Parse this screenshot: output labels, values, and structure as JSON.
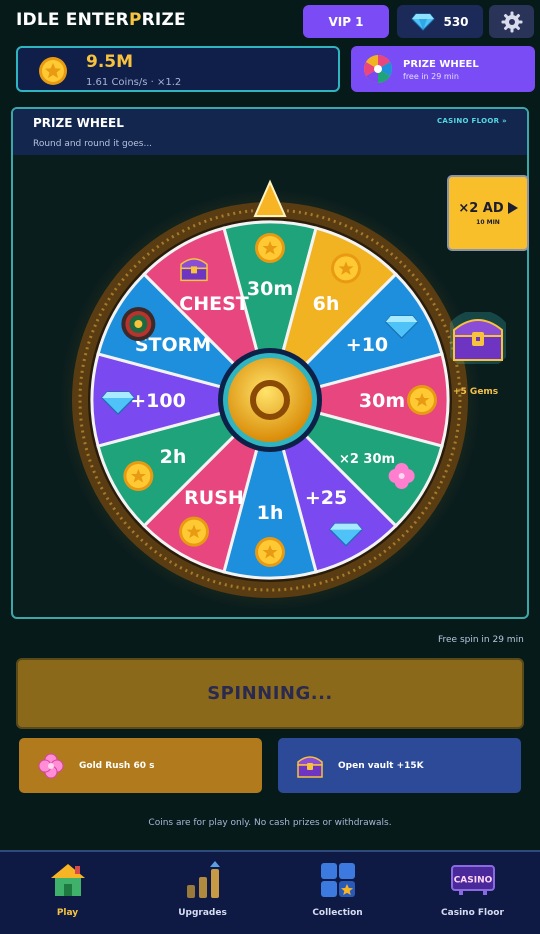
{
  "header": {
    "title_a": "IDLE ENTER",
    "title_b": "P",
    "title_c": "RIZE",
    "vip_label": "VIP 1",
    "gems": "530",
    "settings_icon": "gear-icon"
  },
  "coins": {
    "amount": "9.5M",
    "rate": "1.61 Coins/s  ·  ×1.2",
    "icon": "coin-icon"
  },
  "promo": {
    "title": "PRIZE WHEEL",
    "subtitle": "free in 29 min",
    "icon": "wheel-icon"
  },
  "panel": {
    "title": "PRIZE WHEEL",
    "subtitle": "Round and round it goes...",
    "link": "CASINO FLOOR »"
  },
  "ad_button": {
    "main": "×2 AD",
    "sub": "10 MIN"
  },
  "side_reward": {
    "label": "+5 Gems",
    "icon": "chest-icon"
  },
  "wheel": {
    "segments": [
      {
        "label": "30m",
        "color": "#1fa37a",
        "icon": "coin-icon"
      },
      {
        "label": "6h",
        "color": "#f2b322",
        "icon": "coin-icon"
      },
      {
        "label": "+10",
        "color": "#1d8fdc",
        "icon": "gem-icon"
      },
      {
        "label": "30m",
        "color": "#e8467f",
        "icon": "coin-icon"
      },
      {
        "label": "×2 30m",
        "color": "#1fa37a",
        "icon": "clover-icon"
      },
      {
        "label": "+25",
        "color": "#7a49ef",
        "icon": "gem-icon"
      },
      {
        "label": "1h",
        "color": "#1d8fdc",
        "icon": "coin-icon"
      },
      {
        "label": "RUSH",
        "color": "#e8467f",
        "icon": "coin-icon"
      },
      {
        "label": "2h",
        "color": "#1fa37a",
        "icon": "coin-icon"
      },
      {
        "label": "+100",
        "color": "#7a49ef",
        "icon": "gem-icon"
      },
      {
        "label": "STORM",
        "color": "#1d8fdc",
        "icon": "roulette-icon"
      },
      {
        "label": "CHEST",
        "color": "#e8467f",
        "icon": "chest-icon"
      }
    ]
  },
  "free_spin": "Free spin in 29 min",
  "spin_button": "SPINNING...",
  "actions": {
    "gold_rush": "Gold Rush 60 s",
    "vault": "Open vault +15K"
  },
  "disclaimer": "Coins are for play only. No cash prizes or withdrawals.",
  "nav": [
    {
      "label": "Play",
      "icon": "house-icon",
      "active": true
    },
    {
      "label": "Upgrades",
      "icon": "bar-chart-icon",
      "active": false
    },
    {
      "label": "Collection",
      "icon": "grid-icon",
      "active": false
    },
    {
      "label": "Casino Floor",
      "icon": "casino-sign-icon",
      "active": false
    }
  ],
  "nav_casino_text": "CASINO"
}
